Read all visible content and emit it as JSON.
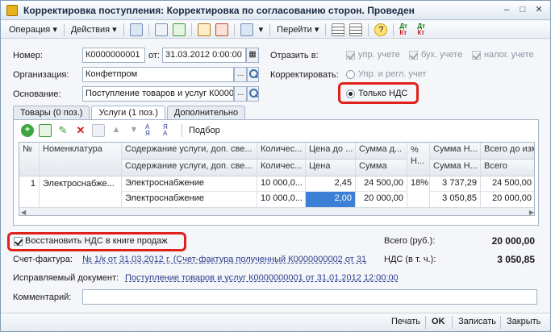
{
  "window": {
    "title": "Корректировка поступления: Корректировка по согласованию сторон. Проведен"
  },
  "toolbar": {
    "operation": "Операция",
    "actions": "Действия",
    "goto": "Перейти"
  },
  "header": {
    "number_label": "Номер:",
    "number_value": "К0000000001",
    "date_label": "от:",
    "date_value": "31.03.2012  0:00:00",
    "org_label": "Организация:",
    "org_value": "Конфетпром",
    "basis_label": "Основание:",
    "basis_value": "Поступление товаров и услуг К0000",
    "reflect_label": "Отразить в:",
    "reflect_upr": "упр. учете",
    "reflect_buh": "бух. учете",
    "reflect_nal": "налог. учете",
    "adjust_label": "Корректировать:",
    "adjust_opt1": "Упр. и регл. учет",
    "adjust_opt2": "Только НДС"
  },
  "tabs": [
    {
      "label": "Товары (0 поз.)"
    },
    {
      "label": "Услуги (1 поз.)"
    },
    {
      "label": "Дополнительно"
    }
  ],
  "panel_toolbar": {
    "pick": "Подбор"
  },
  "table": {
    "headers": [
      "№",
      "Номенклатура",
      "Содержание услуги, доп. све...",
      "Количес...",
      "Цена до ...",
      "Сумма д...",
      "% Н...",
      "Сумма Н...",
      "Всего до изм..."
    ],
    "subheaders": [
      "",
      "",
      "Содержание услуги, доп. све...",
      "Количес...",
      "Цена",
      "Сумма",
      "",
      "Сумма Н...",
      "Всего"
    ],
    "row1": [
      "1",
      "Электроснабже...",
      "Электроснабжение",
      "10 000,0...",
      "2,45",
      "24 500,00",
      "18%",
      "3 737,29",
      "24 500,00"
    ],
    "row2": [
      "",
      "",
      "Электроснабжение",
      "10 000,0...",
      "2,00",
      "20 000,00",
      "",
      "3 050,85",
      "20 000,00"
    ]
  },
  "restore_vat": "Восстановить НДС в книге продаж",
  "totals": {
    "total_label": "Всего (руб.):",
    "total_value": "20 000,00",
    "vat_label": "НДС (в т. ч.):",
    "vat_value": "3 050,85"
  },
  "invoice": {
    "label": "Счет-фактура:",
    "value": "№ 1/к от 31.03.2012 г. (Счет-фактура полученный К0000000002 от 31"
  },
  "corrected_doc": {
    "label": "Исправляемый документ:",
    "value": "Поступление товаров и услуг К0000000001 от 31.01.2012 12:00:00"
  },
  "comment": {
    "label": "Комментарий:",
    "value": ""
  },
  "footer": {
    "print": "Печать",
    "ok": "OK",
    "save": "Записать",
    "close": "Закрыть"
  },
  "colors": {
    "highlight_frame": "#e0201a",
    "selected_cell": "#3d7fd6"
  }
}
